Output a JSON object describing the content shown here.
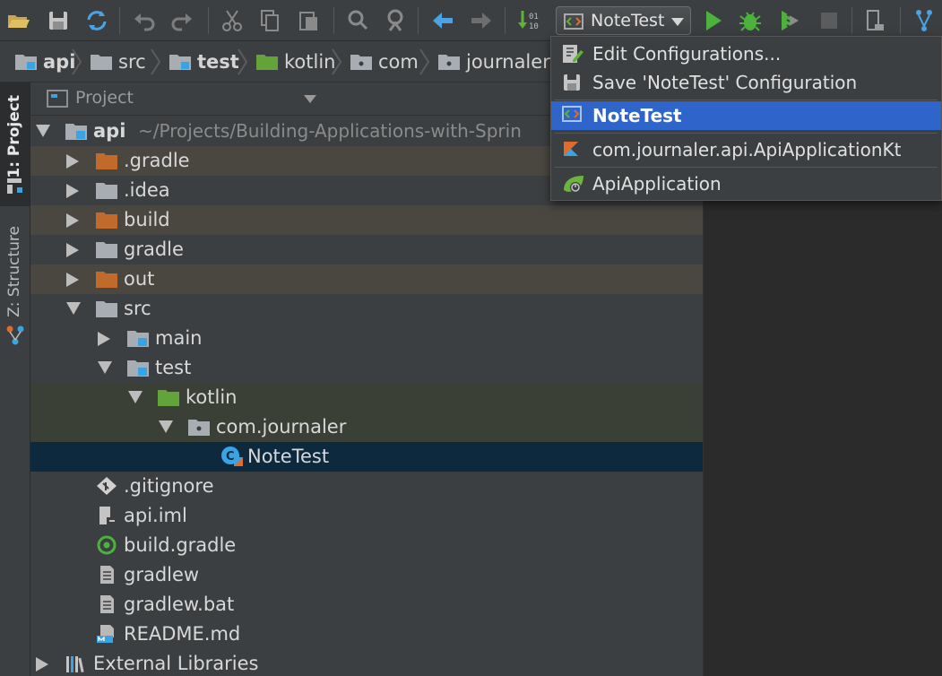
{
  "toolbar": {
    "run_config": "NoteTest",
    "icons": [
      "open-folder-icon",
      "save-icon",
      "sync-icon",
      "undo-icon",
      "redo-icon",
      "cut-icon",
      "copy-icon",
      "paste-icon",
      "find-icon",
      "replace-icon",
      "back-icon",
      "forward-icon",
      "build-icon",
      "run-icon",
      "debug-icon",
      "coverage-icon",
      "stop-icon",
      "sdk-manager-icon",
      "vcs-icon"
    ]
  },
  "breadcrumb": [
    "api",
    "src",
    "test",
    "kotlin",
    "com",
    "journaler"
  ],
  "tool_strip": {
    "project": "1: Project",
    "structure": "Z: Structure"
  },
  "project_panel": {
    "title": "Project",
    "tree": [
      {
        "label": "api",
        "sub": "~/Projects/Building-Applications-with-Sprin"
      },
      {
        "label": ".gradle"
      },
      {
        "label": ".idea"
      },
      {
        "label": "build"
      },
      {
        "label": "gradle"
      },
      {
        "label": "out"
      },
      {
        "label": "src"
      },
      {
        "label": "main"
      },
      {
        "label": "test"
      },
      {
        "label": "kotlin"
      },
      {
        "label": "com.journaler"
      },
      {
        "label": "NoteTest"
      },
      {
        "label": ".gitignore"
      },
      {
        "label": "api.iml"
      },
      {
        "label": "build.gradle"
      },
      {
        "label": "gradlew"
      },
      {
        "label": "gradlew.bat"
      },
      {
        "label": "README.md"
      },
      {
        "label": "External Libraries"
      }
    ]
  },
  "popup": {
    "items": [
      {
        "label": "Edit Configurations..."
      },
      {
        "label": "Save 'NoteTest' Configuration"
      },
      {
        "label": "NoteTest"
      },
      {
        "label": "com.journaler.api.ApiApplicationKt"
      },
      {
        "label": "ApiApplication"
      }
    ]
  },
  "colors": {
    "panel_bg": "#3c3f41",
    "editor_bg": "#2b2b2b",
    "selection": "#0d293e",
    "popup_selection": "#2f65ca",
    "excluded_folder": "#c26a2b",
    "test_folder": "#5b8c2a",
    "source_folder": "#3aa3e3"
  }
}
